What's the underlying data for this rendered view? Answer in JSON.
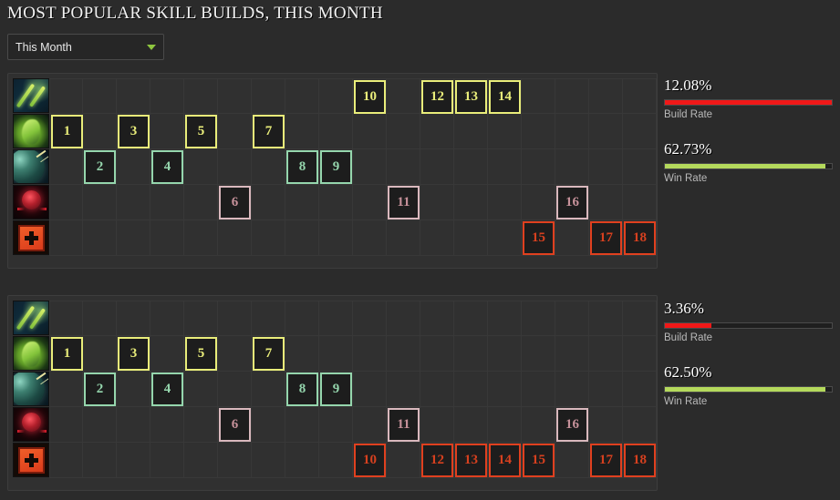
{
  "header": {
    "title": "MOST POPULAR SKILL BUILDS, THIS MONTH",
    "timeframe_selected": "This Month",
    "timeframe_options": [
      "This Month"
    ],
    "caret_icon": "chevron-down-icon"
  },
  "grid": {
    "columns": 18,
    "rows": 5,
    "row_icons": [
      {
        "name": "arrows-skill-icon",
        "style": "ico-arrows"
      },
      {
        "name": "serpent-skill-icon",
        "style": "ico-serpent"
      },
      {
        "name": "planet-skill-icon",
        "style": "ico-planet"
      },
      {
        "name": "orb-skill-icon",
        "style": "ico-orb"
      },
      {
        "name": "talent-tree-icon",
        "style": "ico-talent"
      }
    ]
  },
  "builds": [
    {
      "id": "build-1",
      "pips": [
        {
          "level": 1,
          "row": 1,
          "col": 1,
          "color": "yellow"
        },
        {
          "level": 2,
          "row": 2,
          "col": 2,
          "color": "green"
        },
        {
          "level": 3,
          "row": 1,
          "col": 3,
          "color": "yellow"
        },
        {
          "level": 4,
          "row": 2,
          "col": 4,
          "color": "green"
        },
        {
          "level": 5,
          "row": 1,
          "col": 5,
          "color": "yellow"
        },
        {
          "level": 6,
          "row": 3,
          "col": 6,
          "color": "pink"
        },
        {
          "level": 7,
          "row": 1,
          "col": 7,
          "color": "yellow"
        },
        {
          "level": 8,
          "row": 2,
          "col": 8,
          "color": "green"
        },
        {
          "level": 9,
          "row": 2,
          "col": 9,
          "color": "green"
        },
        {
          "level": 10,
          "row": 0,
          "col": 10,
          "color": "yellow"
        },
        {
          "level": 11,
          "row": 3,
          "col": 11,
          "color": "pink"
        },
        {
          "level": 12,
          "row": 0,
          "col": 12,
          "color": "yellow"
        },
        {
          "level": 13,
          "row": 0,
          "col": 13,
          "color": "yellow"
        },
        {
          "level": 14,
          "row": 0,
          "col": 14,
          "color": "yellow"
        },
        {
          "level": 15,
          "row": 4,
          "col": 15,
          "color": "red"
        },
        {
          "level": 16,
          "row": 3,
          "col": 16,
          "color": "pink"
        },
        {
          "level": 17,
          "row": 4,
          "col": 17,
          "color": "red"
        },
        {
          "level": 18,
          "row": 4,
          "col": 18,
          "color": "red"
        }
      ],
      "stats": {
        "build_rate_value": "12.08%",
        "build_rate_label": "Build Rate",
        "build_rate_pct": 100,
        "win_rate_value": "62.73%",
        "win_rate_label": "Win Rate",
        "win_rate_pct": 96
      }
    },
    {
      "id": "build-2",
      "pips": [
        {
          "level": 1,
          "row": 1,
          "col": 1,
          "color": "yellow"
        },
        {
          "level": 2,
          "row": 2,
          "col": 2,
          "color": "green"
        },
        {
          "level": 3,
          "row": 1,
          "col": 3,
          "color": "yellow"
        },
        {
          "level": 4,
          "row": 2,
          "col": 4,
          "color": "green"
        },
        {
          "level": 5,
          "row": 1,
          "col": 5,
          "color": "yellow"
        },
        {
          "level": 6,
          "row": 3,
          "col": 6,
          "color": "pink"
        },
        {
          "level": 7,
          "row": 1,
          "col": 7,
          "color": "yellow"
        },
        {
          "level": 8,
          "row": 2,
          "col": 8,
          "color": "green"
        },
        {
          "level": 9,
          "row": 2,
          "col": 9,
          "color": "green"
        },
        {
          "level": 10,
          "row": 4,
          "col": 10,
          "color": "red"
        },
        {
          "level": 11,
          "row": 3,
          "col": 11,
          "color": "pink"
        },
        {
          "level": 12,
          "row": 4,
          "col": 12,
          "color": "red"
        },
        {
          "level": 13,
          "row": 4,
          "col": 13,
          "color": "red"
        },
        {
          "level": 14,
          "row": 4,
          "col": 14,
          "color": "red"
        },
        {
          "level": 15,
          "row": 4,
          "col": 15,
          "color": "red"
        },
        {
          "level": 16,
          "row": 3,
          "col": 16,
          "color": "pink"
        },
        {
          "level": 17,
          "row": 4,
          "col": 17,
          "color": "red"
        },
        {
          "level": 18,
          "row": 4,
          "col": 18,
          "color": "red"
        }
      ],
      "stats": {
        "build_rate_value": "3.36%",
        "build_rate_label": "Build Rate",
        "build_rate_pct": 28,
        "win_rate_value": "62.50%",
        "win_rate_label": "Win Rate",
        "win_rate_pct": 96
      }
    }
  ],
  "colors": {
    "yellow": "#e9ed7a",
    "green": "#95d6ad",
    "pink": "#d9b8bd",
    "red": "#e0401f",
    "build_bar": "#f01818",
    "win_bar": "#b4d95c"
  }
}
